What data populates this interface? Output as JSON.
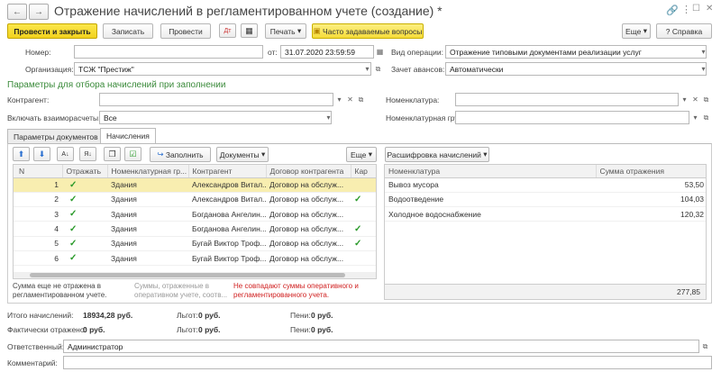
{
  "window": {
    "title": "Отражение начислений в регламентированном учете (создание) *",
    "nav_back": "←",
    "nav_forward": "→",
    "star": "☆",
    "menu": "⋮",
    "minimize": "☐",
    "close": "✕"
  },
  "toolbar": {
    "post_close": "Провести и закрыть",
    "save": "Записать",
    "post": "Провести",
    "print": "Печать",
    "faq": "Часто задаваемые вопросы",
    "more": "Еще",
    "help": "Справка"
  },
  "header": {
    "number_label": "Номер:",
    "number_value": "",
    "from_label": "от:",
    "date_value": "31.07.2020 23:59:59",
    "operation_label": "Вид операции:",
    "operation_value": "Отражение типовыми документами реализации услуг",
    "org_label": "Организация:",
    "org_value": "ТСЖ \"Престиж\"",
    "advance_label": "Зачет авансов:",
    "advance_value": "Автоматически"
  },
  "filter": {
    "section_title": "Параметры для отбора начислений при заполнении",
    "contractor_label": "Контрагент:",
    "contractor_value": "",
    "nomenclature_label": "Номенклатура:",
    "nomenclature_value": "",
    "settlement_label": "Включать взаиморасчеты:",
    "settlement_value": "Все",
    "group_label": "Номенклатурная группа:",
    "group_value": ""
  },
  "tabs": [
    "Параметры документов",
    "Начисления"
  ],
  "table_toolbar": {
    "fill": "Заполнить",
    "documents": "Документы",
    "more": "Еще",
    "breakdown": "Расшифровка начислений"
  },
  "left_table": {
    "columns": [
      "N",
      "Отражать",
      "Номенклатурная гр...",
      "Контрагент",
      "Договор контрагента",
      "Кар"
    ],
    "rows": [
      {
        "n": "1",
        "checked": "✓",
        "group": "Здания",
        "contractor": "Александров Витал...",
        "contract": "Договор на обслуж...",
        "card": ""
      },
      {
        "n": "2",
        "checked": "✓",
        "group": "Здания",
        "contractor": "Александров Витал...",
        "contract": "Договор на обслуж...",
        "card": "✓"
      },
      {
        "n": "3",
        "checked": "✓",
        "group": "Здания",
        "contractor": "Богданова Ангелин...",
        "contract": "Договор на обслуж...",
        "card": ""
      },
      {
        "n": "4",
        "checked": "✓",
        "group": "Здания",
        "contractor": "Богданова Ангелин...",
        "contract": "Договор на обслуж...",
        "card": "✓"
      },
      {
        "n": "5",
        "checked": "✓",
        "group": "Здания",
        "contractor": "Бугай Виктор Троф...",
        "contract": "Договор на обслуж...",
        "card": "✓"
      },
      {
        "n": "6",
        "checked": "✓",
        "group": "Здания",
        "contractor": "Бугай Виктор Троф...",
        "contract": "Договор на обслуж...",
        "card": ""
      }
    ]
  },
  "right_table": {
    "columns": [
      "Номенклатура",
      "Сумма отражения"
    ],
    "rows": [
      {
        "name": "Вывоз мусора",
        "sum": "53,50"
      },
      {
        "name": "Водоотведение",
        "sum": "104,03"
      },
      {
        "name": "Холодное водоснабжение",
        "sum": "120,32"
      }
    ],
    "total": "277,85"
  },
  "notes": {
    "not_reflected": "Сумма еще не отражена в регламентированном учете.",
    "reflected_operative": "Суммы, отраженные в оперативном учете, соотв...",
    "mismatch": "Не совпадают суммы оперативного и регламентированного учета."
  },
  "totals": {
    "accrued_label": "Итого начислений:",
    "accrued_value": "18934,28 руб.",
    "benefits_label": "Льгот:",
    "benefits_value": "0 руб.",
    "penalties_label": "Пени:",
    "penalties_value": "0 руб.",
    "reflected_label": "Фактически отражено:",
    "reflected_value": "0 руб.",
    "benefits2_label": "Льгот:",
    "benefits2_value": "0 руб.",
    "penalties2_label": "Пени:",
    "penalties2_value": "0 руб."
  },
  "footer": {
    "responsible_label": "Ответственный:",
    "responsible_value": "Администратор",
    "comment_label": "Комментарий:",
    "comment_value": ""
  }
}
